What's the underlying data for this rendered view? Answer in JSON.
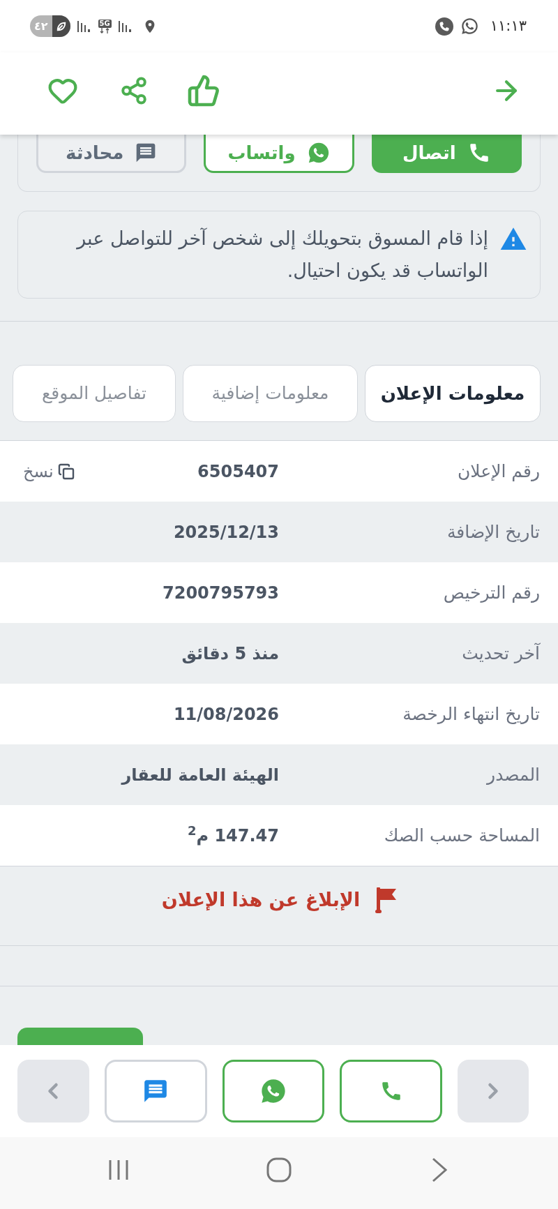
{
  "status_bar": {
    "battery": "٤٢",
    "network": "5G",
    "time": "١١:١٣"
  },
  "contact_buttons": [
    {
      "kind": "call",
      "label": "اتصال"
    },
    {
      "kind": "whatsapp",
      "label": "واتساب"
    },
    {
      "kind": "chat",
      "label": "محادثة"
    }
  ],
  "warning": {
    "text": "إذا قام المسوق بتحويلك إلى شخص آخر للتواصل عبر الواتساب قد يكون احتيال."
  },
  "tabs": [
    {
      "label": "معلومات الإعلان",
      "selected": true
    },
    {
      "label": "معلومات إضافية",
      "selected": false
    },
    {
      "label": "تفاصيل الموقع",
      "selected": false
    }
  ],
  "details": [
    {
      "label": "رقم الإعلان",
      "value": "6505407",
      "action": "نسخ"
    },
    {
      "label": "تاريخ الإضافة",
      "value": "2025/12/13"
    },
    {
      "label": "رقم الترخيص",
      "value": "7200795793"
    },
    {
      "label": "آخر تحديث",
      "value": "منذ 5 دقائق"
    },
    {
      "label": "تاريخ انتهاء الرخصة",
      "value": "11/08/2026"
    },
    {
      "label": "المصدر",
      "value": "الهيئة العامة للعقار"
    },
    {
      "label": "المساحة حسب الصك",
      "value": "147.47 م$^{2}$"
    }
  ],
  "report": {
    "label": "الإبلاغ عن هذا الإعلان"
  },
  "bottom_bar": {
    "buttons": [
      {
        "kind": "call"
      },
      {
        "kind": "whatsapp"
      },
      {
        "kind": "chat"
      }
    ]
  }
}
